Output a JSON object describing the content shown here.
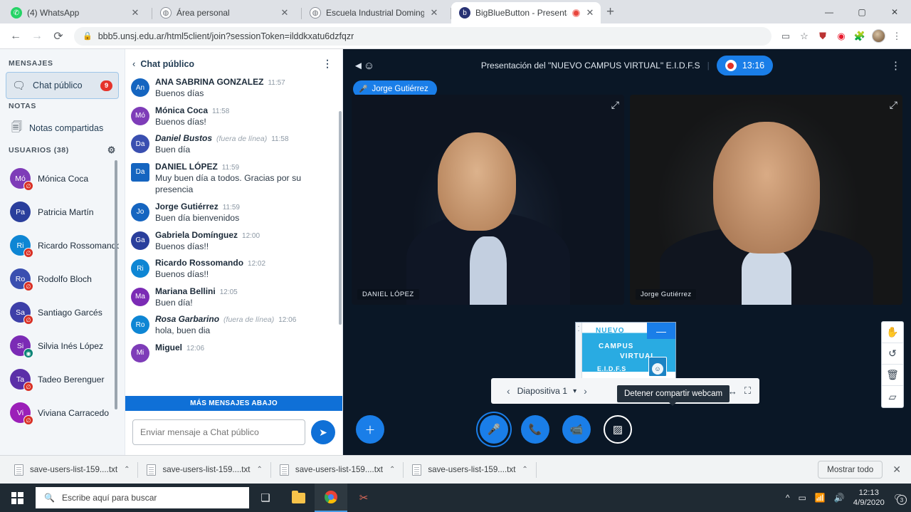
{
  "browser": {
    "tabs": [
      {
        "title": "(4) WhatsApp",
        "icon": "whatsapp-icon",
        "active": false,
        "recording": false
      },
      {
        "title": "Área personal",
        "icon": "globe-icon",
        "active": false,
        "recording": false
      },
      {
        "title": "Escuela Industrial Domingo Faust",
        "icon": "globe-icon",
        "active": false,
        "recording": false
      },
      {
        "title": "BigBlueButton - Presentación",
        "icon": "bigbluebutton-icon",
        "active": true,
        "recording": true
      }
    ],
    "newtab_label": "+",
    "close_label": "✕",
    "nav": {
      "back": "←",
      "forward": "→",
      "reload": "⟳"
    },
    "url": "bbb5.unsj.edu.ar/html5client/join?sessionToken=ilddkxatu6dzfqzr",
    "lock_icon": "lock-icon",
    "toolbar_icons": [
      "camera-icon",
      "star-icon",
      "pdf-icon",
      "opera-icon",
      "extensions-icon",
      "profile-avatar",
      "kebab-menu-icon"
    ],
    "window_controls": [
      "minimize",
      "maximize",
      "close"
    ]
  },
  "sidebar": {
    "messages_heading": "MENSAJES",
    "public_chat": {
      "label": "Chat público",
      "icon": "chat-icon",
      "badge": "9"
    },
    "notes_heading": "NOTAS",
    "shared_notes": {
      "label": "Notas compartidas",
      "icon": "notes-icon"
    },
    "users_heading": "USUARIOS (38)",
    "users_settings_icon": "gear-icon",
    "users": [
      {
        "initials": "Mó",
        "name": "Mónica Coca",
        "color": "#7e3cb8",
        "status": "muted"
      },
      {
        "initials": "Pa",
        "name": "Patricia Martín",
        "color": "#2a3f9c",
        "status": "none"
      },
      {
        "initials": "Ri",
        "name": "Ricardo Rossomando",
        "color": "#0e86d4",
        "status": "muted"
      },
      {
        "initials": "Ro",
        "name": "Rodolfo Bloch",
        "color": "#3a4fb0",
        "status": "muted"
      },
      {
        "initials": "Sa",
        "name": "Santiago Garcés",
        "color": "#3d3fa8",
        "status": "muted"
      },
      {
        "initials": "Si",
        "name": "Silvia Inés López",
        "color": "#7b2bb5",
        "status": "talking"
      },
      {
        "initials": "Ta",
        "name": "Tadeo Berenguer",
        "color": "#5b2fa8",
        "status": "muted"
      },
      {
        "initials": "Vi",
        "name": "Viviana Carracedo",
        "color": "#9b1fb8",
        "status": "muted"
      }
    ]
  },
  "chat": {
    "header": "Chat público",
    "back_icon": "chevron-left-icon",
    "options_icon": "kebab-menu-icon",
    "more_below_label": "MÁS MENSAJES ABAJO",
    "input_placeholder": "Enviar mensaje a Chat público",
    "input_value": "",
    "send_icon": "send-icon",
    "messages": [
      {
        "initials": "An",
        "name": "ANA SABRINA GONZALEZ",
        "offline": "",
        "time": "11:57",
        "text": "Buenos días",
        "color": "#1565c0",
        "square": false
      },
      {
        "initials": "Mó",
        "name": "Mónica Coca",
        "offline": "",
        "time": "11:58",
        "text": "Buenos días!",
        "color": "#7e3cb8",
        "square": false
      },
      {
        "initials": "Da",
        "name": "Daniel Bustos",
        "offline": "(fuera de línea)",
        "time": "11:58",
        "text": "Buen día",
        "color": "#3a4fb0",
        "square": false
      },
      {
        "initials": "Da",
        "name": "DANIEL LÓPEZ",
        "offline": "",
        "time": "11:59",
        "text": "Muy buen día a todos. Gracias por su presencia",
        "color": "#1565c0",
        "square": true
      },
      {
        "initials": "Jo",
        "name": "Jorge Gutiérrez",
        "offline": "",
        "time": "11:59",
        "text": "Buen día bienvenidos",
        "color": "#1565c0",
        "square": false
      },
      {
        "initials": "Ga",
        "name": "Gabriela Domínguez",
        "offline": "",
        "time": "12:00",
        "text": "Buenos días!!",
        "color": "#2a3f9c",
        "square": false
      },
      {
        "initials": "Ri",
        "name": "Ricardo Rossomando",
        "offline": "",
        "time": "12:02",
        "text": "Buenos días!!",
        "color": "#0e86d4",
        "square": false
      },
      {
        "initials": "Ma",
        "name": "Mariana Bellini",
        "offline": "",
        "time": "12:05",
        "text": "Buen día!",
        "color": "#7b2bb5",
        "square": false
      },
      {
        "initials": "Ro",
        "name": "Rosa Garbarino",
        "offline": "(fuera de línea)",
        "time": "12:06",
        "text": "hola, buen dia",
        "color": "#0e86d4",
        "square": false
      },
      {
        "initials": "Mi",
        "name": "Miguel",
        "offline": "",
        "time": "12:06",
        "text": "",
        "color": "#7e3cb8",
        "square": false
      }
    ]
  },
  "meeting": {
    "people_icon": "users-icon",
    "title": "Presentación del \"NUEVO CAMPUS VIRTUAL\" E.I.D.F.S",
    "divider": "|",
    "recording_time": "13:16",
    "recording_icon": "record-dot-icon",
    "options_icon": "kebab-menu-icon",
    "active_talker": {
      "name": "Jorge Gutiérrez",
      "icon": "microphone-icon"
    },
    "webcams": [
      {
        "label": "DANIEL LÓPEZ",
        "expand_icon": "expand-icon"
      },
      {
        "label": "Jorge Gutiérrez",
        "expand_icon": "expand-icon"
      }
    ],
    "slide": {
      "line1": "NUEVO",
      "line2": "CAMPUS",
      "line3": "VIRTUAL",
      "line4": "E.I.D.F.S",
      "minimize_label": "—",
      "logo_icon": "school-logo-icon"
    },
    "presentation_bar": {
      "prev_icon": "chevron-left-icon",
      "slide_label": "Diapositiva 1",
      "dropdown_icon": "chevron-down-icon",
      "next_icon": "chevron-right-icon",
      "reset_icon": "reset-zoom-icon",
      "fullscreen_icon": "fullscreen-icon"
    },
    "tooltip": "Detener compartir webcam",
    "whiteboard_tools": [
      {
        "icon": "hand-pan-icon",
        "name": "pan-tool"
      },
      {
        "icon": "undo-icon",
        "name": "undo-tool"
      },
      {
        "icon": "trash-icon",
        "name": "delete-annotations-tool"
      },
      {
        "icon": "multi-user-whiteboard-icon",
        "name": "multi-user-whiteboard-tool"
      }
    ],
    "actions": {
      "add_icon": "plus-icon",
      "mic_icon": "microphone-icon",
      "audio_icon": "phone-icon",
      "webcam_icon": "video-camera-icon",
      "screenshare_icon": "screen-share-off-icon"
    }
  },
  "downloads": {
    "items": [
      {
        "name": "save-users-list-159....txt",
        "icon": "file-icon",
        "caret": "chevron-up-icon"
      },
      {
        "name": "save-users-list-159....txt",
        "icon": "file-icon",
        "caret": "chevron-up-icon"
      },
      {
        "name": "save-users-list-159....txt",
        "icon": "file-icon",
        "caret": "chevron-up-icon"
      },
      {
        "name": "save-users-list-159....txt",
        "icon": "file-icon",
        "caret": "chevron-up-icon"
      }
    ],
    "show_all_label": "Mostrar todo",
    "close_label": "✕"
  },
  "taskbar": {
    "start_icon": "windows-start-icon",
    "search_placeholder": "Escribe aquí para buscar",
    "search_icon": "search-icon",
    "items": [
      {
        "icon": "task-view-icon",
        "name": "task-view"
      },
      {
        "icon": "file-explorer-icon",
        "name": "file-explorer"
      },
      {
        "icon": "chrome-icon",
        "name": "google-chrome"
      },
      {
        "icon": "snipping-tool-icon",
        "name": "snipping-tool"
      }
    ],
    "tray": {
      "chevron": "^",
      "icons": [
        "webcam-tray-icon",
        "wifi-icon",
        "volume-icon"
      ],
      "time": "12:13",
      "date": "4/9/2020",
      "notifications_icon": "notifications-icon",
      "notifications_count": "3"
    }
  },
  "colors": {
    "accent": "#1a7ee8",
    "badge_red": "#e5332a",
    "stage_bg": "#0a1726",
    "sidebar_bg": "#f3f6f9"
  }
}
